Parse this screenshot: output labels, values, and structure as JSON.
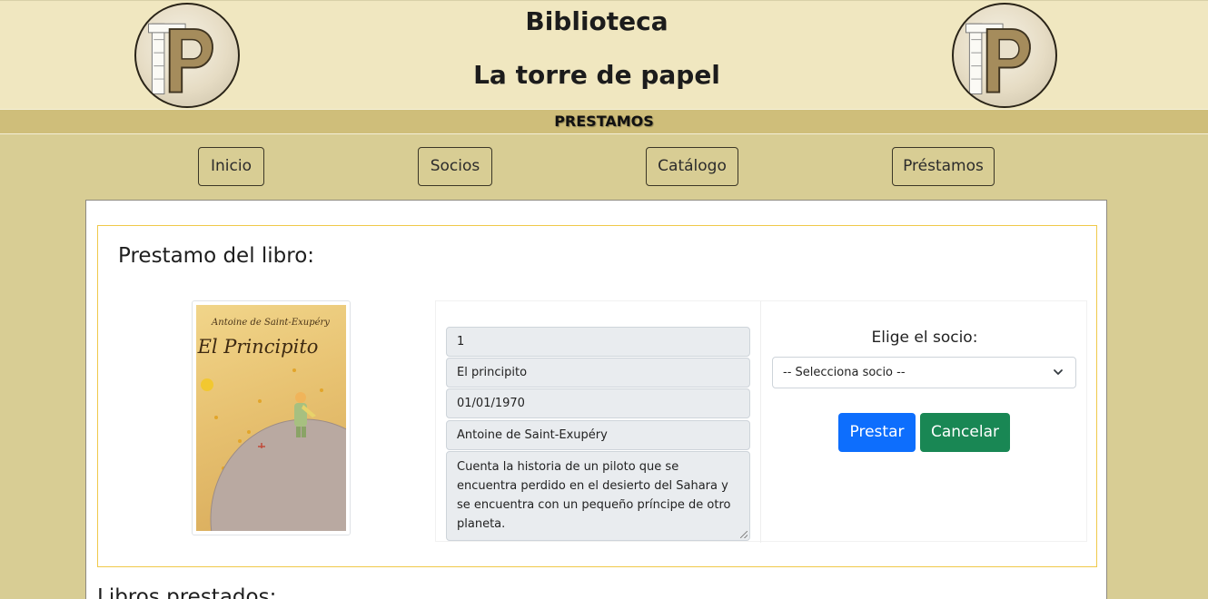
{
  "header": {
    "title_line1": "Biblioteca",
    "title_line2": "La torre de papel",
    "logo_icon": "tower-of-books-logo"
  },
  "section": {
    "title": "PRESTAMOS"
  },
  "nav": {
    "items": [
      {
        "label": "Inicio"
      },
      {
        "label": "Socios"
      },
      {
        "label": "Catálogo"
      },
      {
        "label": "Préstamos"
      }
    ]
  },
  "loan_form": {
    "title": "Prestamo del libro:",
    "cover": {
      "author": "Antoine de Saint-Exupéry",
      "title": "El Principito"
    },
    "fields": {
      "id": "1",
      "book_title": "El principito",
      "date": "01/01/1970",
      "author": "Antoine de Saint-Exupéry",
      "synopsis": "Cuenta la historia de un piloto que se encuentra perdido en el desierto del Sahara y se encuentra con un pequeño príncipe de otro planeta."
    },
    "socio_label": "Elige el socio:",
    "socio_select_value": "-- Selecciona socio --",
    "lend_button": "Prestar",
    "cancel_button": "Cancelar"
  },
  "lent_books": {
    "title": "Libros prestados:"
  },
  "colors": {
    "page_background": "#d8cd94",
    "header_background": "#f0e7c0",
    "section_bar": "#cfbe7a",
    "primary": "#0d6efd",
    "success": "#198754",
    "panel_border": "#f0c94a"
  }
}
